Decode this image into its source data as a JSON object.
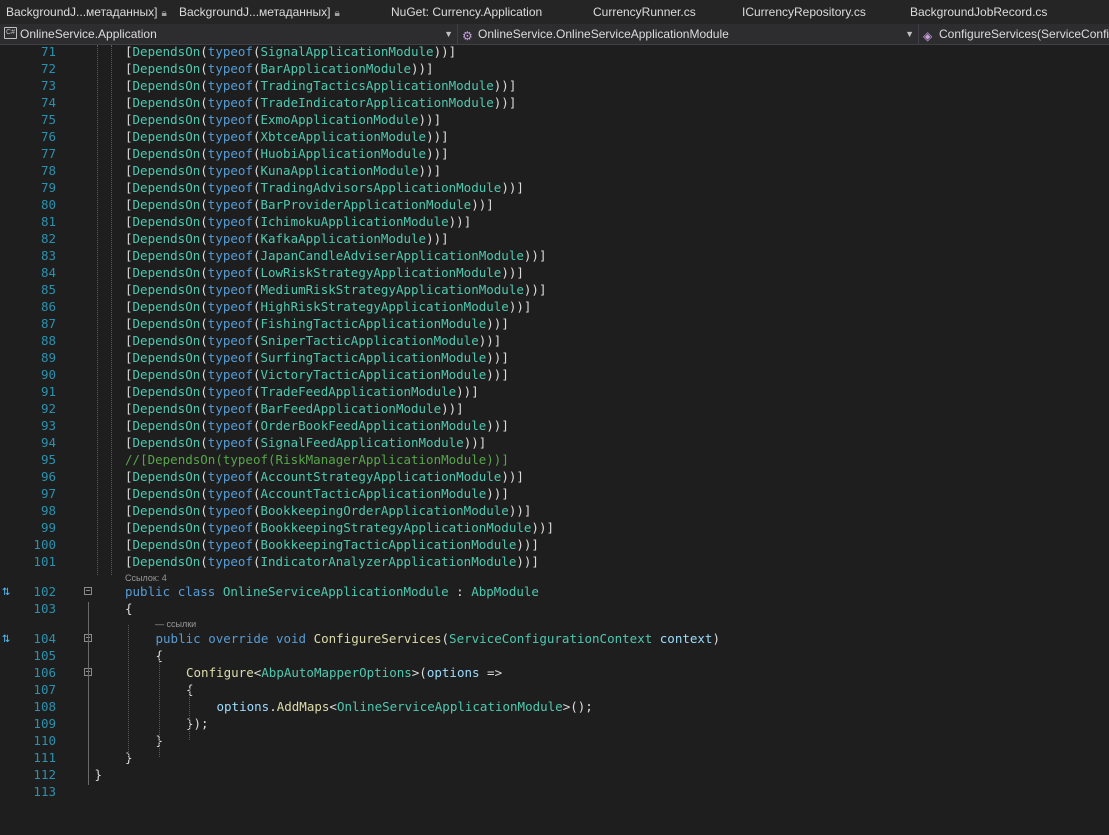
{
  "tabs": [
    {
      "label": "BackgroundJ...метаданных]",
      "lock": true,
      "width": 173
    },
    {
      "label": "BackgroundJ...метаданных]",
      "lock": true,
      "width": 212
    },
    {
      "label": "NuGet: Currency.Application",
      "lock": false,
      "width": 202
    },
    {
      "label": "CurrencyRunner.cs",
      "lock": false,
      "width": 149
    },
    {
      "label": "ICurrencyRepository.cs",
      "lock": false,
      "width": 168
    },
    {
      "label": "BackgroundJobRecord.cs",
      "lock": false,
      "width": 205
    }
  ],
  "navbar": {
    "project": "OnlineService.Application",
    "project_icon": "C#",
    "class": "OnlineService.OnlineServiceApplicationModule",
    "member": "ConfigureServices(ServiceConfi"
  },
  "modules": [
    {
      "ln": "71",
      "name": "SignalApplicationModule"
    },
    {
      "ln": "72",
      "name": "BarApplicationModule"
    },
    {
      "ln": "73",
      "name": "TradingTacticsApplicationModule"
    },
    {
      "ln": "74",
      "name": "TradeIndicatorApplicationModule"
    },
    {
      "ln": "75",
      "name": "ExmoApplicationModule"
    },
    {
      "ln": "76",
      "name": "XbtceApplicationModule"
    },
    {
      "ln": "77",
      "name": "HuobiApplicationModule"
    },
    {
      "ln": "78",
      "name": "KunaApplicationModule"
    },
    {
      "ln": "79",
      "name": "TradingAdvisorsApplicationModule"
    },
    {
      "ln": "80",
      "name": "BarProviderApplicationModule"
    },
    {
      "ln": "81",
      "name": "IchimokuApplicationModule"
    },
    {
      "ln": "82",
      "name": "KafkaApplicationModule"
    },
    {
      "ln": "83",
      "name": "JapanCandleAdviserApplicationModule"
    },
    {
      "ln": "84",
      "name": "LowRiskStrategyApplicationModule"
    },
    {
      "ln": "85",
      "name": "MediumRiskStrategyApplicationModule"
    },
    {
      "ln": "86",
      "name": "HighRiskStrategyApplicationModule"
    },
    {
      "ln": "87",
      "name": "FishingTacticApplicationModule"
    },
    {
      "ln": "88",
      "name": "SniperTacticApplicationModule"
    },
    {
      "ln": "89",
      "name": "SurfingTacticApplicationModule"
    },
    {
      "ln": "90",
      "name": "VictoryTacticApplicationModule"
    },
    {
      "ln": "91",
      "name": "TradeFeedApplicationModule"
    },
    {
      "ln": "92",
      "name": "BarFeedApplicationModule"
    },
    {
      "ln": "93",
      "name": "OrderBookFeedApplicationModule"
    },
    {
      "ln": "94",
      "name": "SignalFeedApplicationModule"
    },
    {
      "ln": "95",
      "name": "RiskManagerApplicationModule",
      "commented": true
    },
    {
      "ln": "96",
      "name": "AccountStrategyApplicationModule"
    },
    {
      "ln": "97",
      "name": "AccountTacticApplicationModule"
    },
    {
      "ln": "98",
      "name": "BookkeepingOrderApplicationModule"
    },
    {
      "ln": "99",
      "name": "BookkeepingStrategyApplicationModule"
    },
    {
      "ln": "100",
      "name": "BookkeepingTacticApplicationModule"
    },
    {
      "ln": "101",
      "name": "IndicatorAnalyzerApplicationModule"
    }
  ],
  "tokens": {
    "attr": "DependsOn",
    "typeof": "typeof",
    "comment_prefix": "//"
  },
  "lens": {
    "class_refs": "Ссылок: 4",
    "method_refs": "— ссылки"
  },
  "tail": [
    {
      "ln": "102",
      "fold": true,
      "gutter": true
    },
    {
      "ln": "103"
    },
    {
      "ln": "104",
      "fold": true,
      "gutter": true
    },
    {
      "ln": "105"
    },
    {
      "ln": "106",
      "fold": true
    },
    {
      "ln": "107"
    },
    {
      "ln": "108"
    },
    {
      "ln": "109"
    },
    {
      "ln": "110"
    },
    {
      "ln": "111"
    },
    {
      "ln": "112"
    },
    {
      "ln": "113"
    }
  ],
  "code": {
    "kw_public": "public",
    "kw_class": "class",
    "class_name": "OnlineServiceApplicationModule",
    "colon": " : ",
    "base": "AbpModule",
    "brace_open": "{",
    "brace_close": "}",
    "kw_override": "override",
    "kw_void": "void",
    "method": "ConfigureServices",
    "param_type": "ServiceConfigurationContext",
    "param_name": "context",
    "configure": "Configure",
    "options_type": "AbpAutoMapperOptions",
    "lambda_param": "options",
    "arrow": " =>",
    "addmaps_target": "options",
    "addmaps": "AddMaps",
    "addmaps_type": "OnlineServiceApplicationModule",
    "close_lambda": "});",
    "addmaps_end": "();"
  }
}
